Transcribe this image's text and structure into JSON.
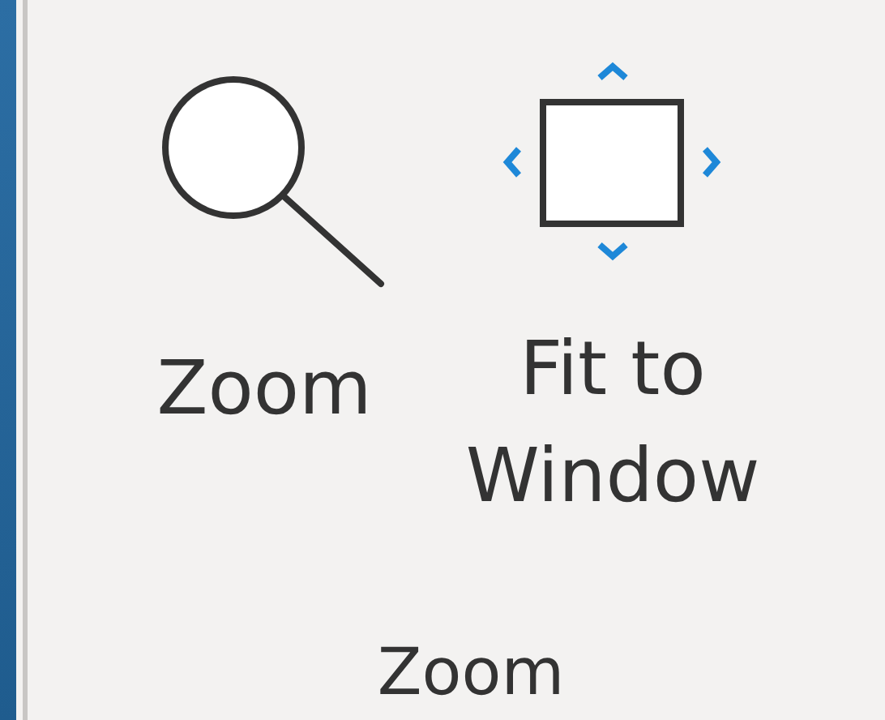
{
  "group": {
    "label": "Zoom"
  },
  "buttons": [
    {
      "kind": "zoom",
      "label": "Zoom"
    },
    {
      "kind": "fit",
      "label": "Fit to Window"
    }
  ]
}
